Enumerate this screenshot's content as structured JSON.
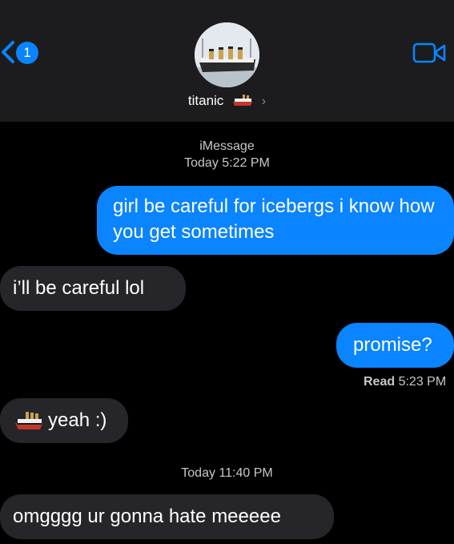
{
  "header": {
    "back_badge": "1",
    "contact_name": "titanic",
    "contact_emoji": "ship-emoji",
    "chevron": "›",
    "accent_color": "#0a84ff",
    "background_color": "#1c1c1e"
  },
  "thread": {
    "service_label": "iMessage",
    "first_timestamp_day": "Today",
    "first_timestamp_time": "5:22 PM",
    "messages": [
      {
        "direction": "sent",
        "text": "girl be careful for icebergs i know how you get sometimes"
      },
      {
        "direction": "received",
        "text": "i’ll be careful lol"
      },
      {
        "direction": "sent",
        "text": "promise?"
      },
      {
        "direction": "received",
        "text": "yeah :)",
        "icon": "ship-emoji"
      },
      {
        "direction": "received",
        "text": "omgggg ur gonna hate meeeee"
      }
    ],
    "read_label": "Read",
    "read_time": "5:23 PM",
    "second_timestamp_day": "Today",
    "second_timestamp_time": "11:40 PM"
  },
  "colors": {
    "sent_bubble": "#0a84ff",
    "received_bubble": "#26252a",
    "screen_background": "#000000"
  }
}
